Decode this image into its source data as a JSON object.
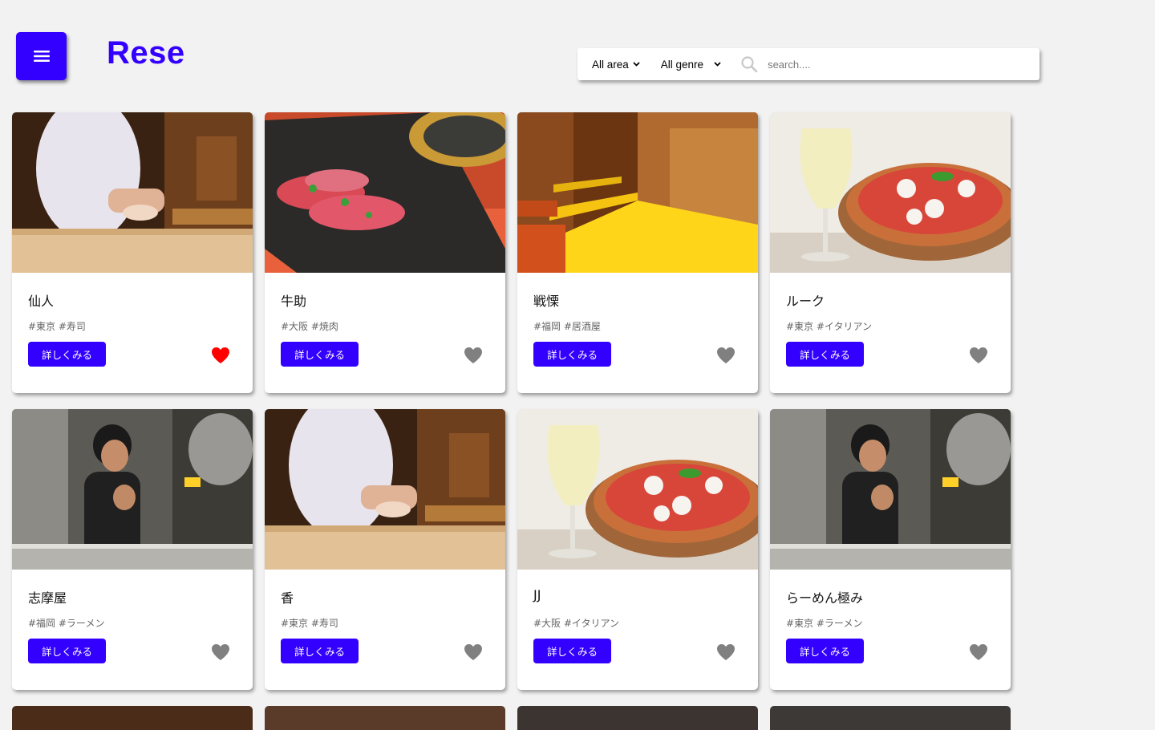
{
  "app": {
    "logo": "Rese"
  },
  "colors": {
    "brand": "#3300ff",
    "favorite_active": "#ff0000",
    "favorite_inactive": "#808080"
  },
  "search": {
    "area_label": "All area",
    "genre_label": "All genre",
    "placeholder": "search...."
  },
  "buttons": {
    "detail_label": "詳しくみる"
  },
  "shops": [
    {
      "name": "仙人",
      "tags": "#東京 #寿司",
      "image": "sushi-chef-photo",
      "favorite": true
    },
    {
      "name": "牛助",
      "tags": "#大阪 #焼肉",
      "image": "wagyu-beef-photo",
      "favorite": false
    },
    {
      "name": "戦慄",
      "tags": "#福岡 #居酒屋",
      "image": "izakaya-interior-photo",
      "favorite": false
    },
    {
      "name": "ルーク",
      "tags": "#東京 #イタリアン",
      "image": "pizza-wine-photo",
      "favorite": false
    },
    {
      "name": "志摩屋",
      "tags": "#福岡 #ラーメン",
      "image": "ramen-kitchen-photo",
      "favorite": false
    },
    {
      "name": "香",
      "tags": "#東京 #寿司",
      "image": "sushi-chef-photo",
      "favorite": false
    },
    {
      "name": "JJ",
      "tags": "#大阪 #イタリアン",
      "image": "pizza-wine-photo",
      "favorite": false
    },
    {
      "name": "らーめん極み",
      "tags": "#東京 #ラーメン",
      "image": "ramen-kitchen-photo",
      "favorite": false
    }
  ]
}
